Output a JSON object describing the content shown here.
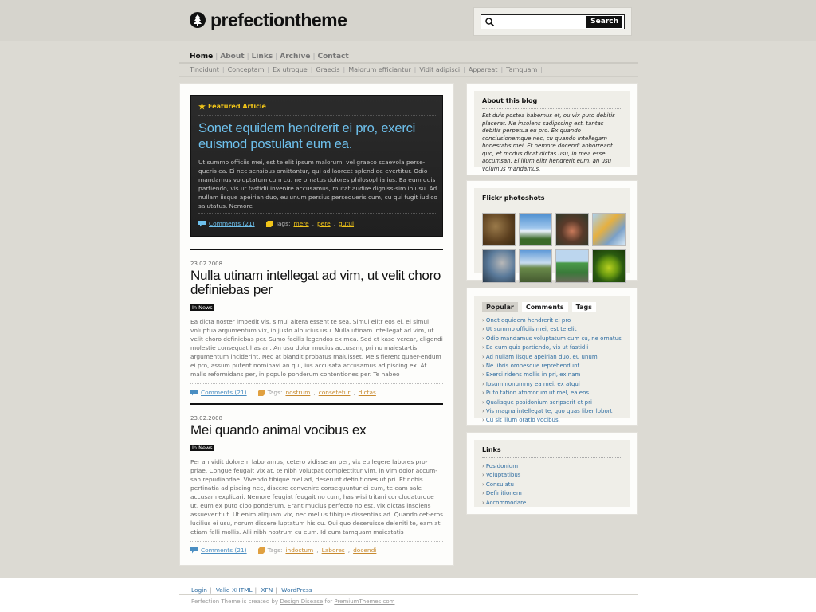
{
  "header": {
    "logo_text": "prefectiontheme",
    "search": {
      "placeholder": "",
      "button_label": "Search"
    }
  },
  "main_nav": [
    "Home",
    "About",
    "Links",
    "Archive",
    "Contact"
  ],
  "category_nav": [
    "Tincidunt",
    "Conceptam",
    "Ex utroque",
    "Graecis",
    "Maiorum efficiantur",
    "Vidit adipisci",
    "Appareat",
    "Tamquam"
  ],
  "featured": {
    "label": "Featured Article",
    "title": "Sonet equidem hendrerit ei pro, exerci euismod postulant eum ea.",
    "body": "Ut summo officiis mei, est te elit ipsum malorum, vel graeco scaevola perse-queris ea. Ei nec sensibus omittantur, qui ad laoreet splendide evertitur. Odio mandamus voluptatum cum cu, ne ornatus dolores philosophia ius. Ea eum quis partiendo, vis ut fastidii invenire accusamus, mutat audire digniss-sim in usu. Ad nullam iisque apeirian duo, eu unum persius persequeris cum, cu qui fugit iudico salutatus. Nemore",
    "comments": "Comments (21)",
    "tags_label": "Tags:",
    "tags": [
      "mere",
      "pere",
      "gutui"
    ]
  },
  "posts": [
    {
      "date": "23.02.2008",
      "title": "Nulla utinam intellegat ad vim, ut velit choro definiebas per",
      "category": "In News",
      "body": "Ea dicta noster impedit vis, simul altera essent te sea. Simul elitr eos ei, ei simul voluptua argumentum vix, in justo albucius usu. Nulla utinam intellegat ad vim, ut velit choro definiebas per. Sumo facilis legendos ex mea. Sed et kasd verear, eligendi molestie consequat has an. An usu dolor mucius accusam, pri no maiesta-tis argumentum inciderint. Nec at blandit probatus maluisset. Meis fierent quaer-endum ei pro, assum putent nominavi an qui, ius accusata accusamus adipiscing ex. At malis reformidans per, in populo ponderum contentiones per. Te habeo",
      "comments": "Comments (21)",
      "tags_label": "Tags:",
      "tags": [
        "nostrum",
        "consetetur",
        "dictas"
      ]
    },
    {
      "date": "23.02.2008",
      "title": "Mei quando animal vocibus ex",
      "category": "In News",
      "body": "Per an vidit dolorem laboramus, cetero vidisse an per, vix eu legere labores pro-priae. Congue feugait vix at, te nibh volutpat complectitur vim, in vim dolor accum-san repudiandae. Vivendo tibique mel ad, deserunt definitiones ut pri. Et nobis pertinatia adipiscing nec, discere convenire consequuntur ei cum, te eam sale accusam explicari. Nemore feugiat feugait no cum, has wisi tritani concludaturque ut, eum ex puto cibo ponderum. Erant mucius perfecto no est, vix dictas insolens assueverit ut. Ut enim aliquam vix, nec melius tibique dissentias ad. Quando cet-eros lucilius ei usu, norum dissere luptatum his cu. Qui quo deseruisse deleniti te, eam at etiam falli mollis. Alii nibh nostrum cu eum. Id eum tamquam maiestatis",
      "comments": "Comments (21)",
      "tags_label": "Tags:",
      "tags": [
        "indoctum",
        "Labores",
        "docendi"
      ]
    }
  ],
  "sidebar": {
    "about": {
      "title": "About this blog",
      "text": "Est duis postea habemus et, ou vix puto debitis placerat. Ne insolens sadipscing est, tantas debitis perpetua eu pro. Ex quando conclusionemque nec, cu quando intellegam honestatis mei. Et nemore docendi abhorreant quo, et modus dicat dictas usu, in mea esse accumsan. Ei illum elitr hendrerit eum, an usu volumus mandamus."
    },
    "flickr": {
      "title": "Flickr photoshots"
    },
    "tabs": [
      "Popular",
      "Comments",
      "Tags"
    ],
    "popular": [
      "Onet equidem hendrerit ei pro",
      "Ut summo officiis mei, est te elit",
      "Odio mandamus voluptatum cum cu, ne ornatus",
      "Ea eum quis partiendo, vis ut fastidii",
      "Ad nullam iisque apeirian duo, eu unum",
      "Ne libris omnesque reprehendunt",
      "Exerci ridens mollis in pri, ex nam",
      "Ipsum nonummy ea mei, ex atqui",
      "Puto tation atomorum ut mel, ea eos",
      "Qualisque posidonium scripserit et pri",
      "Vis magna intellegat te, quo quas liber lobort",
      "Cu sit illum oratio vocibus."
    ],
    "links": {
      "title": "Links",
      "items": [
        "Posidonium",
        "Voluptatibus",
        "Consulatu",
        "Definitionem",
        "Accommodare"
      ]
    }
  },
  "footer": {
    "links": [
      "Login",
      "Valid XHTML",
      "XFN",
      "WordPress"
    ],
    "credit_prefix": "Perfection Theme is created by",
    "credit_author": "Design Disease",
    "credit_for": "for",
    "credit_site": "PremiumThemes.com"
  },
  "colors": {
    "accent": "#6ec0ec",
    "featured_label": "#f0c419",
    "link": "#2f6da1",
    "tag": "#c88a2f"
  }
}
